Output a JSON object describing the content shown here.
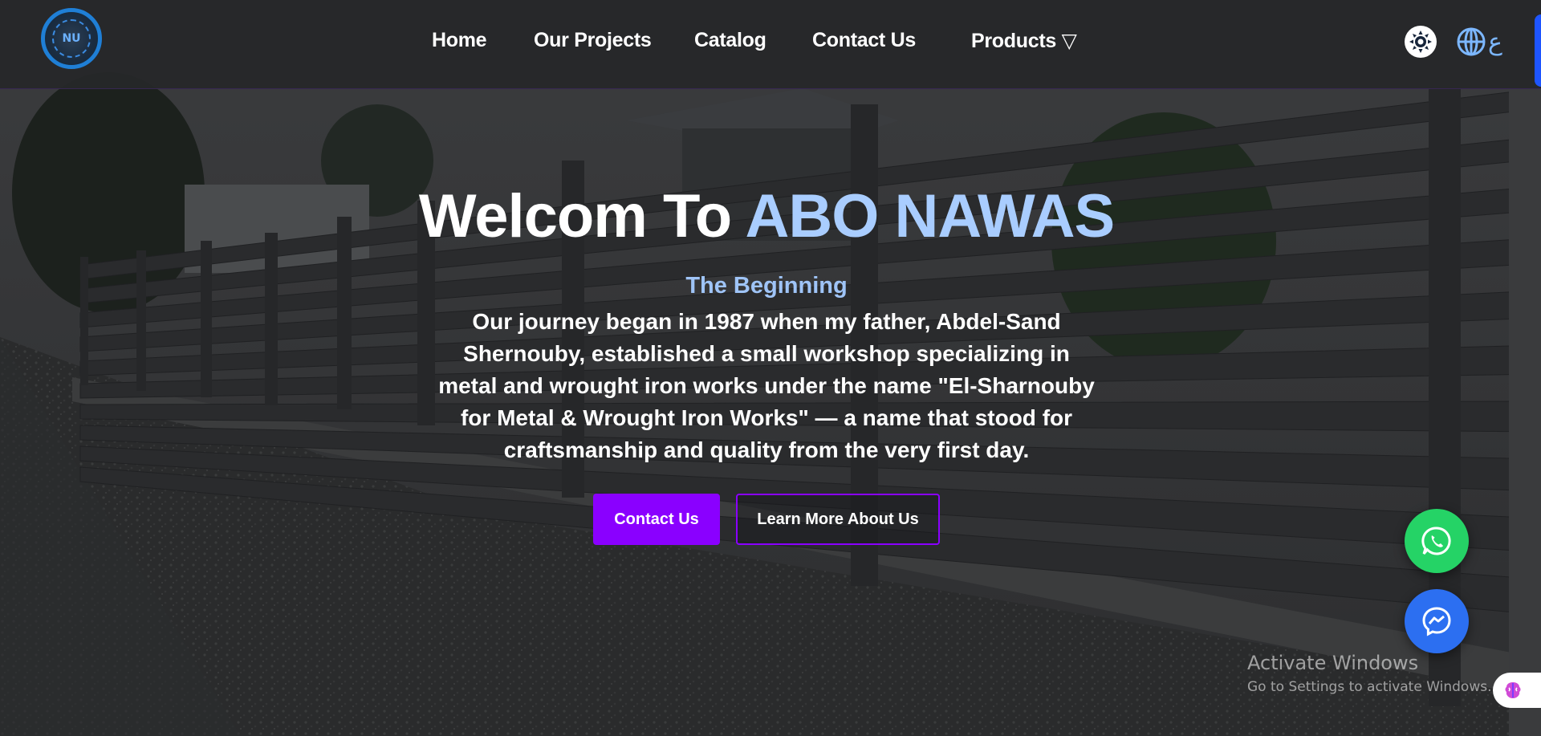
{
  "brand": {
    "logo_text": "NU"
  },
  "nav": {
    "items": [
      {
        "label": "Home"
      },
      {
        "label": "Our Projects"
      },
      {
        "label": "Catalog"
      },
      {
        "label": "Contact Us"
      },
      {
        "label": "Products ▽"
      }
    ],
    "theme_icon": "sun-icon",
    "language_label": "ع"
  },
  "hero": {
    "title_prefix": "Welcom To ",
    "title_brand": "ABO NAWAS",
    "subtitle": "The Beginning",
    "body": "Our journey began in 1987 when my father, Abdel-Sand Shernouby, established a small workshop specializing in metal and wrought iron works under the name \"El-Sharnouby for Metal & Wrought Iron Works\" — a name that stood for craftsmanship and quality from the very first day.",
    "primary_button": "Contact Us",
    "secondary_button": "Learn More About Us"
  },
  "floating": {
    "whatsapp_icon": "whatsapp-icon",
    "messenger_icon": "messenger-icon"
  },
  "watermark": {
    "title": "Activate Windows",
    "subtitle": "Go to Settings to activate Windows."
  },
  "colors": {
    "accent": "#8a00ff",
    "brand_text": "#a9cdff",
    "subtitle_text": "#9fc4f7",
    "whatsapp": "#25d366",
    "messenger": "#2c6ff1",
    "logo_ring": "#1f7fd6"
  }
}
